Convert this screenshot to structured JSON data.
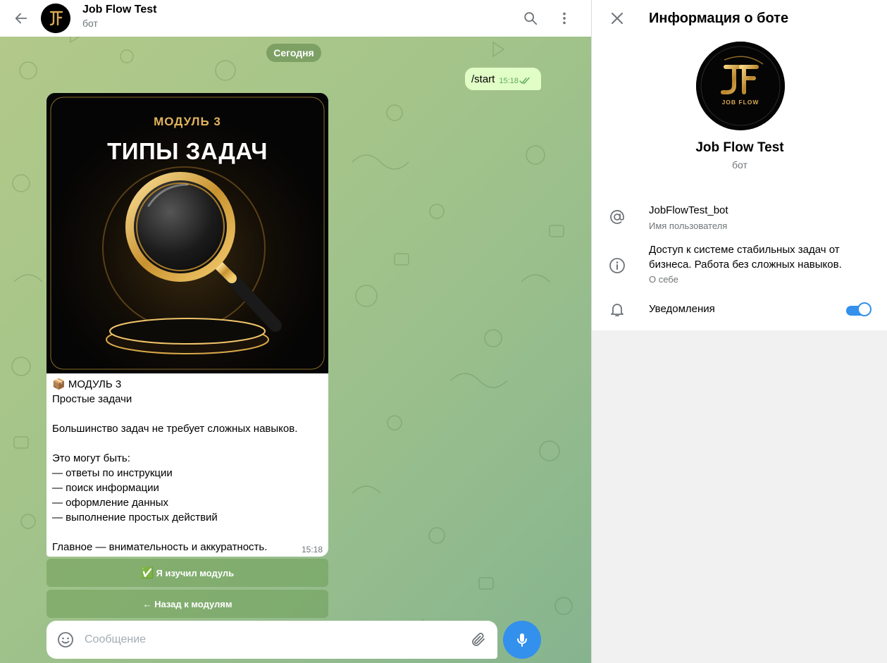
{
  "chat": {
    "title": "Job Flow Test",
    "subtitle": "бот",
    "date_pill": "Сегодня",
    "outgoing": {
      "text": "/start",
      "time": "15:18"
    },
    "incoming": {
      "image_tag": "МОДУЛЬ 3",
      "image_title": "ТИПЫ ЗАДАЧ",
      "text": "📦 МОДУЛЬ 3\nПростые задачи\n\nБольшинство задач не требует сложных навыков.\n\nЭто могут быть:\n— ответы по инструкции\n— поиск информации\n— оформление данных\n— выполнение простых действий\n\nГлавное — внимательность и аккуратность.",
      "time": "15:18"
    },
    "keyboard": [
      {
        "emoji": "✅",
        "label": "Я изучил модуль"
      },
      {
        "emoji": "",
        "label": "← Назад к модулям"
      }
    ],
    "composer": {
      "placeholder": "Сообщение",
      "value": ""
    }
  },
  "info_panel": {
    "title": "Информация о боте",
    "logo_text": "JOB FLOW",
    "name": "Job Flow Test",
    "status": "бот",
    "username": "JobFlowTest_bot",
    "username_label": "Имя пользователя",
    "about": "Доступ к системе стабильных задач от бизнеса. Работа без сложных навыков.",
    "about_label": "О себе",
    "notifications_label": "Уведомления",
    "notifications_on": true
  },
  "colors": {
    "accent": "#3390ec",
    "outgoing_bubble": "#e1fec6",
    "gold": "#e2b45b"
  },
  "icons": [
    "back-arrow-icon",
    "search-icon",
    "more-vertical-icon",
    "close-icon",
    "at-sign-icon",
    "info-icon",
    "bell-icon",
    "smile-icon",
    "paperclip-icon",
    "microphone-icon",
    "double-check-icon"
  ]
}
